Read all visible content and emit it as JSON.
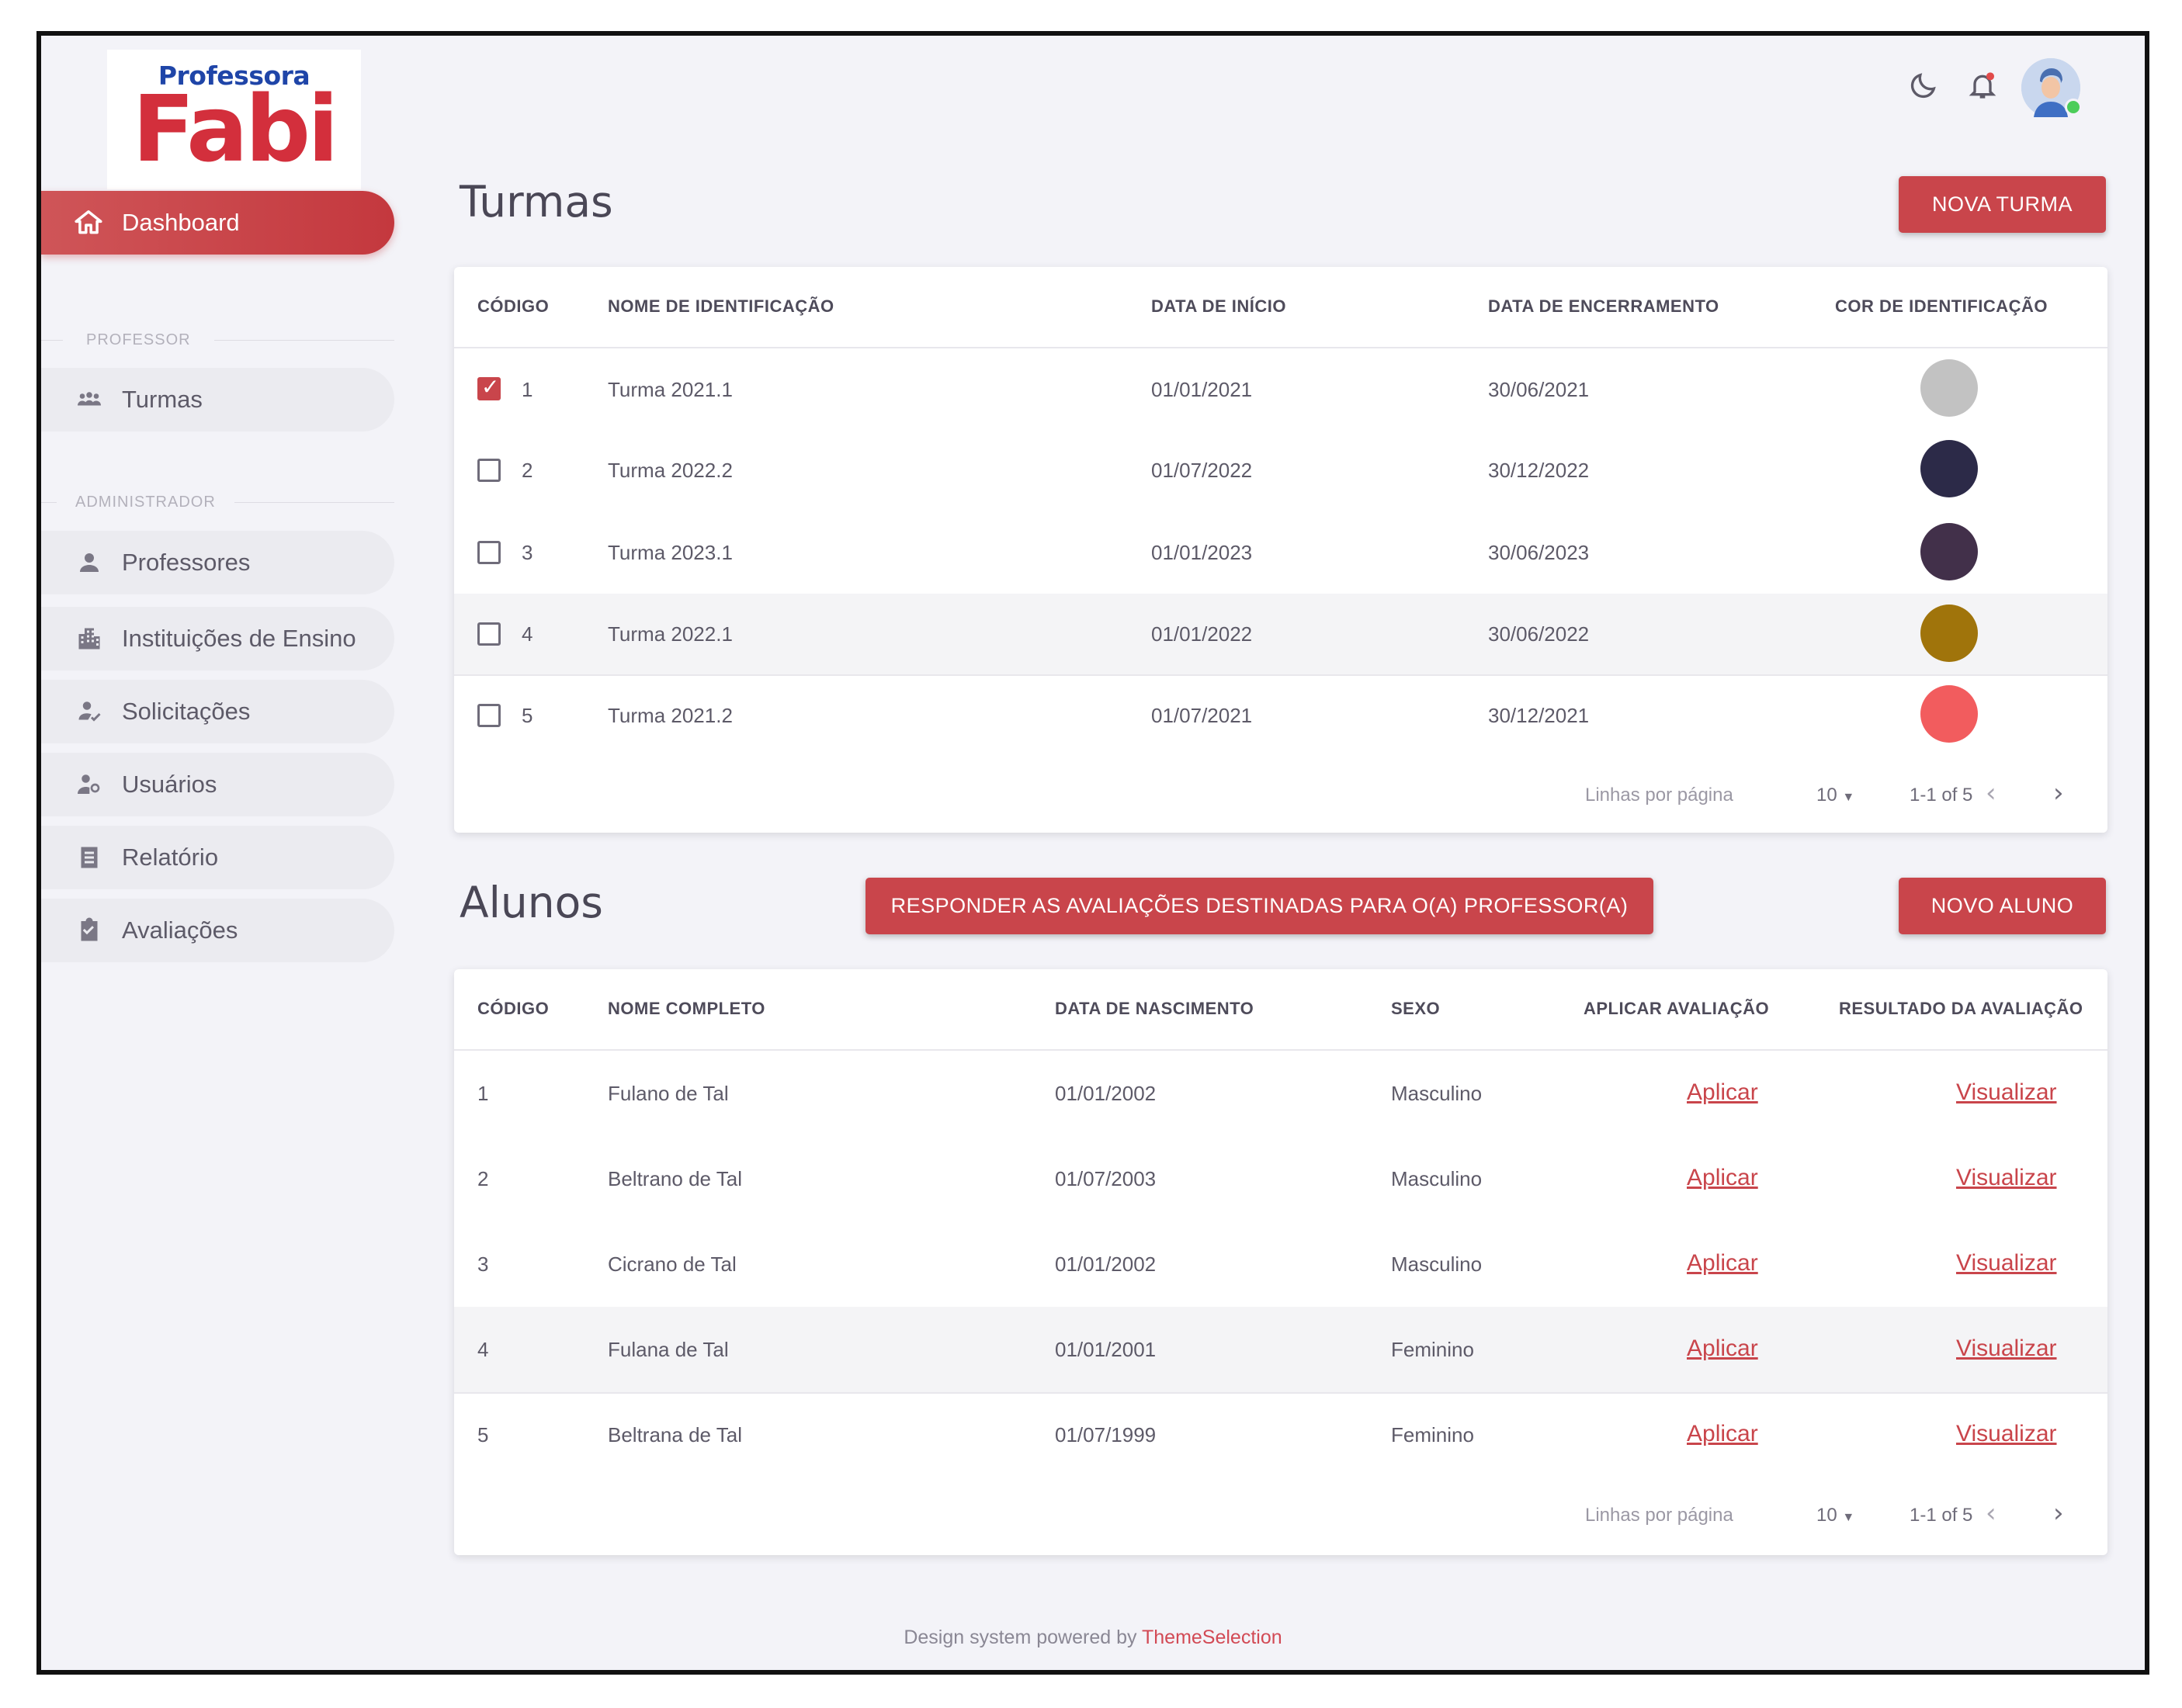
{
  "logo": {
    "line1": "Professora",
    "line2": "Fabi"
  },
  "sidebar": {
    "active": {
      "label": "Dashboard",
      "icon": "home-icon"
    },
    "section_professor": "PROFESSOR",
    "section_admin": "ADMINISTRADOR",
    "items": [
      {
        "label": "Turmas",
        "icon": "group-icon"
      },
      {
        "label": "Professores",
        "icon": "person-icon"
      },
      {
        "label": "Instituições de Ensino",
        "icon": "building-icon"
      },
      {
        "label": "Solicitações",
        "icon": "person-check-icon"
      },
      {
        "label": "Usuários",
        "icon": "users-icon"
      },
      {
        "label": "Relatório",
        "icon": "report-icon"
      },
      {
        "label": "Avaliações",
        "icon": "clipboard-check-icon"
      }
    ]
  },
  "header": {
    "icons": [
      "dark-mode-moon-icon",
      "notification-bell-icon",
      "user-avatar"
    ]
  },
  "turmas": {
    "title": "Turmas",
    "new_button": "NOVA TURMA",
    "columns": [
      "CÓDIGO",
      "NOME DE IDENTIFICAÇÃO",
      "DATA DE INÍCIO",
      "DATA DE ENCERRAMENTO",
      "COR DE IDENTIFICAÇÃO"
    ],
    "rows": [
      {
        "code": "1",
        "name": "Turma 2021.1",
        "start": "01/01/2021",
        "end": "30/06/2021",
        "color": "#c2c2c2",
        "checked": true
      },
      {
        "code": "2",
        "name": "Turma 2022.2",
        "start": "01/07/2022",
        "end": "30/12/2022",
        "color": "#2c2a48",
        "checked": false
      },
      {
        "code": "3",
        "name": "Turma 2023.1",
        "start": "01/01/2023",
        "end": "30/06/2023",
        "color": "#42304a",
        "checked": false
      },
      {
        "code": "4",
        "name": "Turma 2022.1",
        "start": "01/01/2022",
        "end": "30/06/2022",
        "color": "#a0740b",
        "checked": false
      },
      {
        "code": "5",
        "name": "Turma 2021.2",
        "start": "01/07/2021",
        "end": "30/12/2021",
        "color": "#f25c5e",
        "checked": false
      }
    ],
    "pagination": {
      "rows_label": "Linhas por página",
      "rows_value": "10",
      "range": "1-1 of 5"
    }
  },
  "alunos": {
    "title": "Alunos",
    "respond_button": "RESPONDER AS AVALIAÇÕES DESTINADAS PARA O(A) PROFESSOR(A)",
    "new_button": "NOVO ALUNO",
    "columns": [
      "CÓDIGO",
      "NOME COMPLETO",
      "DATA DE NASCIMENTO",
      "SEXO",
      "APLICAR AVALIAÇÃO",
      "RESULTADO DA AVALIAÇÃO"
    ],
    "rows": [
      {
        "code": "1",
        "name": "Fulano de Tal",
        "birth": "01/01/2002",
        "sex": "Masculino",
        "apply": "Aplicar",
        "result": "Visualizar"
      },
      {
        "code": "2",
        "name": "Beltrano de Tal",
        "birth": "01/07/2003",
        "sex": "Masculino",
        "apply": "Aplicar",
        "result": "Visualizar"
      },
      {
        "code": "3",
        "name": "Cicrano de Tal",
        "birth": "01/01/2002",
        "sex": "Masculino",
        "apply": "Aplicar",
        "result": "Visualizar"
      },
      {
        "code": "4",
        "name": "Fulana de Tal",
        "birth": "01/01/2001",
        "sex": "Feminino",
        "apply": "Aplicar",
        "result": "Visualizar"
      },
      {
        "code": "5",
        "name": "Beltrana de Tal",
        "birth": "01/07/1999",
        "sex": "Feminino",
        "apply": "Aplicar",
        "result": "Visualizar"
      }
    ],
    "pagination": {
      "rows_label": "Linhas por página",
      "rows_value": "10",
      "range": "1-1 of 5"
    }
  },
  "footer": {
    "text": "Design system powered by",
    "brand": "ThemeSelection"
  },
  "colors": {
    "accent": "#c9454b",
    "background": "#f3f3f8"
  }
}
